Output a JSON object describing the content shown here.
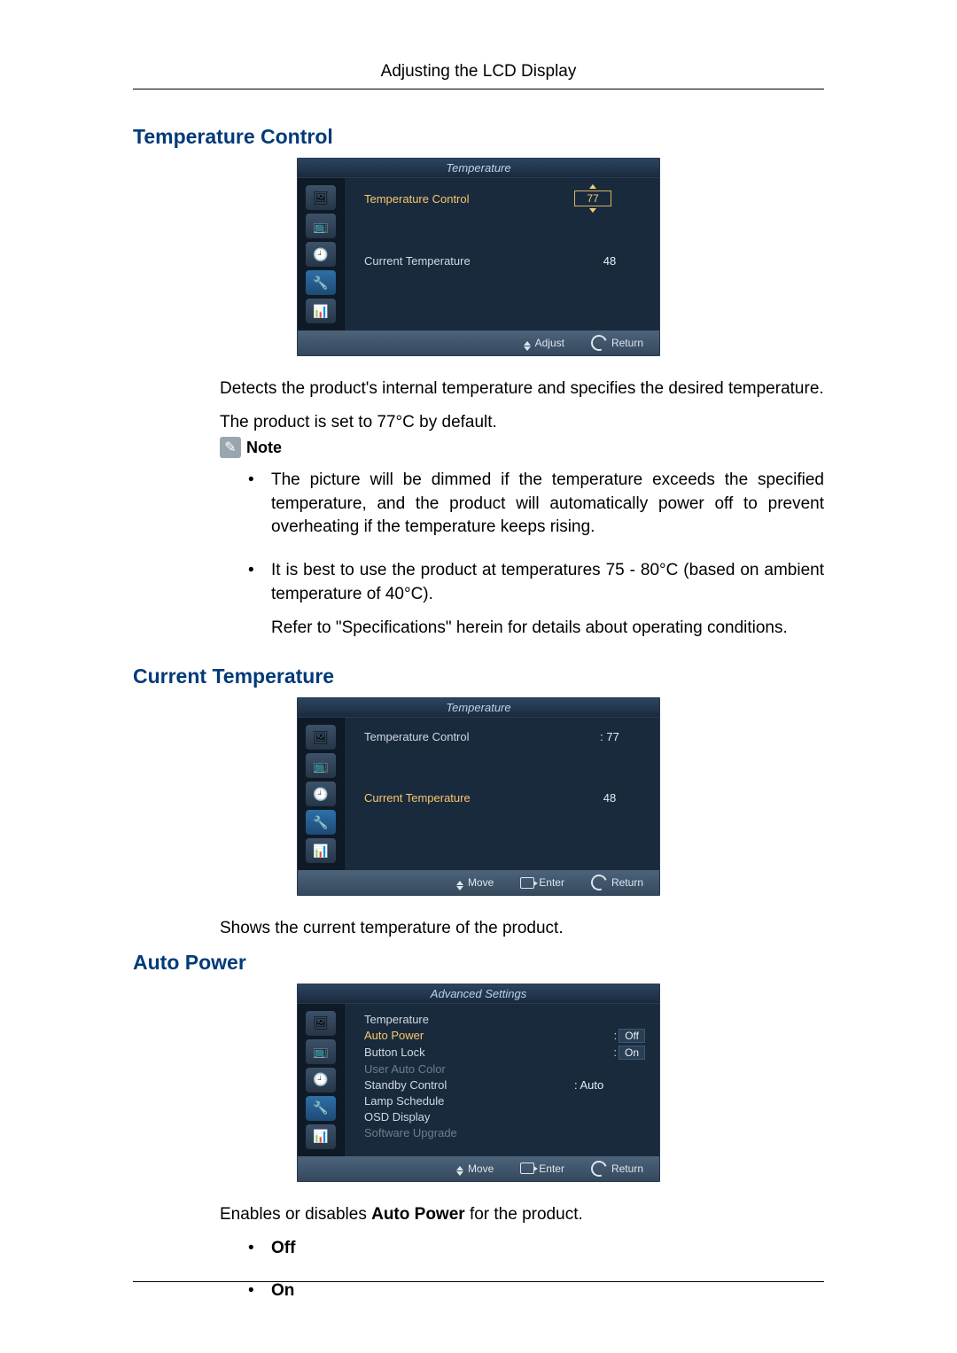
{
  "page_header": "Adjusting the LCD Display",
  "sections": {
    "tc": {
      "title": "Temperature Control",
      "desc1": "Detects the product's internal temperature and specifies the desired temperature.",
      "desc2": "The product is set to 77°C by default.",
      "note_label": "Note",
      "bullets": [
        "The picture will be dimmed if the temperature exceeds the specified temperature, and the product will automatically power off to prevent overheating if the temperature keeps rising.",
        "It is best to use the product at temperatures 75 - 80°C (based on ambient temperature of 40°C)."
      ],
      "refer": "Refer to \"Specifications\" herein for details about operating conditions."
    },
    "ct": {
      "title": "Current Temperature",
      "desc": "Shows the current temperature of the product."
    },
    "ap": {
      "title": "Auto Power",
      "desc_pre": "Enables or disables ",
      "desc_bold": "Auto Power",
      "desc_post": " for the product.",
      "options": [
        "Off",
        "On"
      ]
    }
  },
  "osd": {
    "title_temp": "Temperature",
    "title_adv": "Advanced Settings",
    "labels": {
      "temp_control": "Temperature Control",
      "curr_temp": "Current Temperature"
    },
    "values": {
      "tc_val": "77",
      "tc_val_colon": ": 77",
      "curr_val": "48"
    },
    "adv_items": [
      {
        "label": "Temperature",
        "val": "",
        "cls": ""
      },
      {
        "label": "Auto Power",
        "val": "Off",
        "cls": "highlight"
      },
      {
        "label": "Button Lock",
        "val": "On",
        "cls": ""
      },
      {
        "label": "User Auto Color",
        "val": "",
        "cls": "dim"
      },
      {
        "label": "Standby Control",
        "val": ": Auto",
        "cls": ""
      },
      {
        "label": "Lamp Schedule",
        "val": "",
        "cls": ""
      },
      {
        "label": "OSD Display",
        "val": "",
        "cls": ""
      },
      {
        "label": "Software Upgrade",
        "val": "",
        "cls": "dim"
      }
    ],
    "footer": {
      "adjust": "Adjust",
      "move": "Move",
      "enter": "Enter",
      "return": "Return"
    }
  },
  "icon_glyphs": [
    "🖼",
    "📺",
    "🕘",
    "🔧",
    "📊"
  ]
}
